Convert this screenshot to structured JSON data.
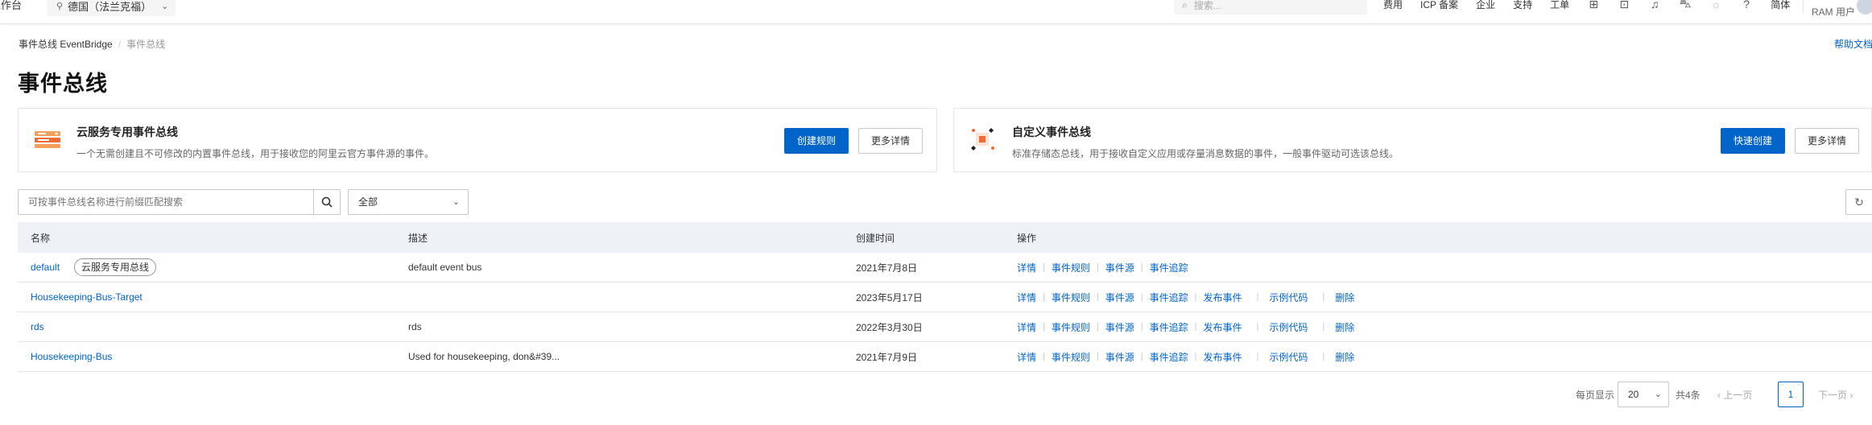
{
  "topbar": {
    "workbench": "工作台",
    "region": "德国（法兰克福）",
    "search_placeholder": "搜索...",
    "nav": [
      "费用",
      "ICP 备案",
      "企业",
      "支持",
      "工单"
    ],
    "lang": "简体",
    "user": "RAM 用户"
  },
  "breadcrumb": {
    "root": "事件总线 EventBridge",
    "current": "事件总线"
  },
  "help_doc": "帮助文档",
  "page_title": "事件总线",
  "cards": [
    {
      "title": "云服务专用事件总线",
      "desc": "一个无需创建且不可修改的内置事件总线，用于接收您的阿里云官方事件源的事件。",
      "primary": "创建规则",
      "secondary": "更多详情"
    },
    {
      "title": "自定义事件总线",
      "desc": "标准存储态总线，用于接收自定义应用或存量消息数据的事件，一般事件驱动可选该总线。",
      "primary": "快速创建",
      "secondary": "更多详情"
    }
  ],
  "filter": {
    "placeholder": "可按事件总线名称进行前缀匹配搜索",
    "select_value": "全部"
  },
  "table": {
    "headers": {
      "name": "名称",
      "desc": "描述",
      "created": "创建时间",
      "ops": "操作"
    },
    "tag": "云服务专用总线",
    "ops": {
      "detail": "详情",
      "rules": "事件规则",
      "sources": "事件源",
      "trace": "事件追踪",
      "publish": "发布事件",
      "sample": "示例代码",
      "delete": "删除"
    },
    "rows": [
      {
        "name": "default",
        "desc": "default event bus",
        "created": "2021年7月8日"
      },
      {
        "name": "Housekeeping-Bus-Target",
        "desc": "",
        "created": "2023年5月17日"
      },
      {
        "name": "rds",
        "desc": "rds",
        "created": "2022年3月30日"
      },
      {
        "name": "Housekeeping-Bus",
        "desc": "Used for housekeeping, don&#39...",
        "created": "2021年7月9日"
      }
    ]
  },
  "pagination": {
    "per_page_label": "每页显示",
    "per_page": "20",
    "total": "共4条",
    "prev": "上一页",
    "current": "1",
    "next": "下一页"
  },
  "colors": {
    "primary": "#0064c8",
    "header_bg": "#eef1f6",
    "border": "#e5e5e5"
  }
}
